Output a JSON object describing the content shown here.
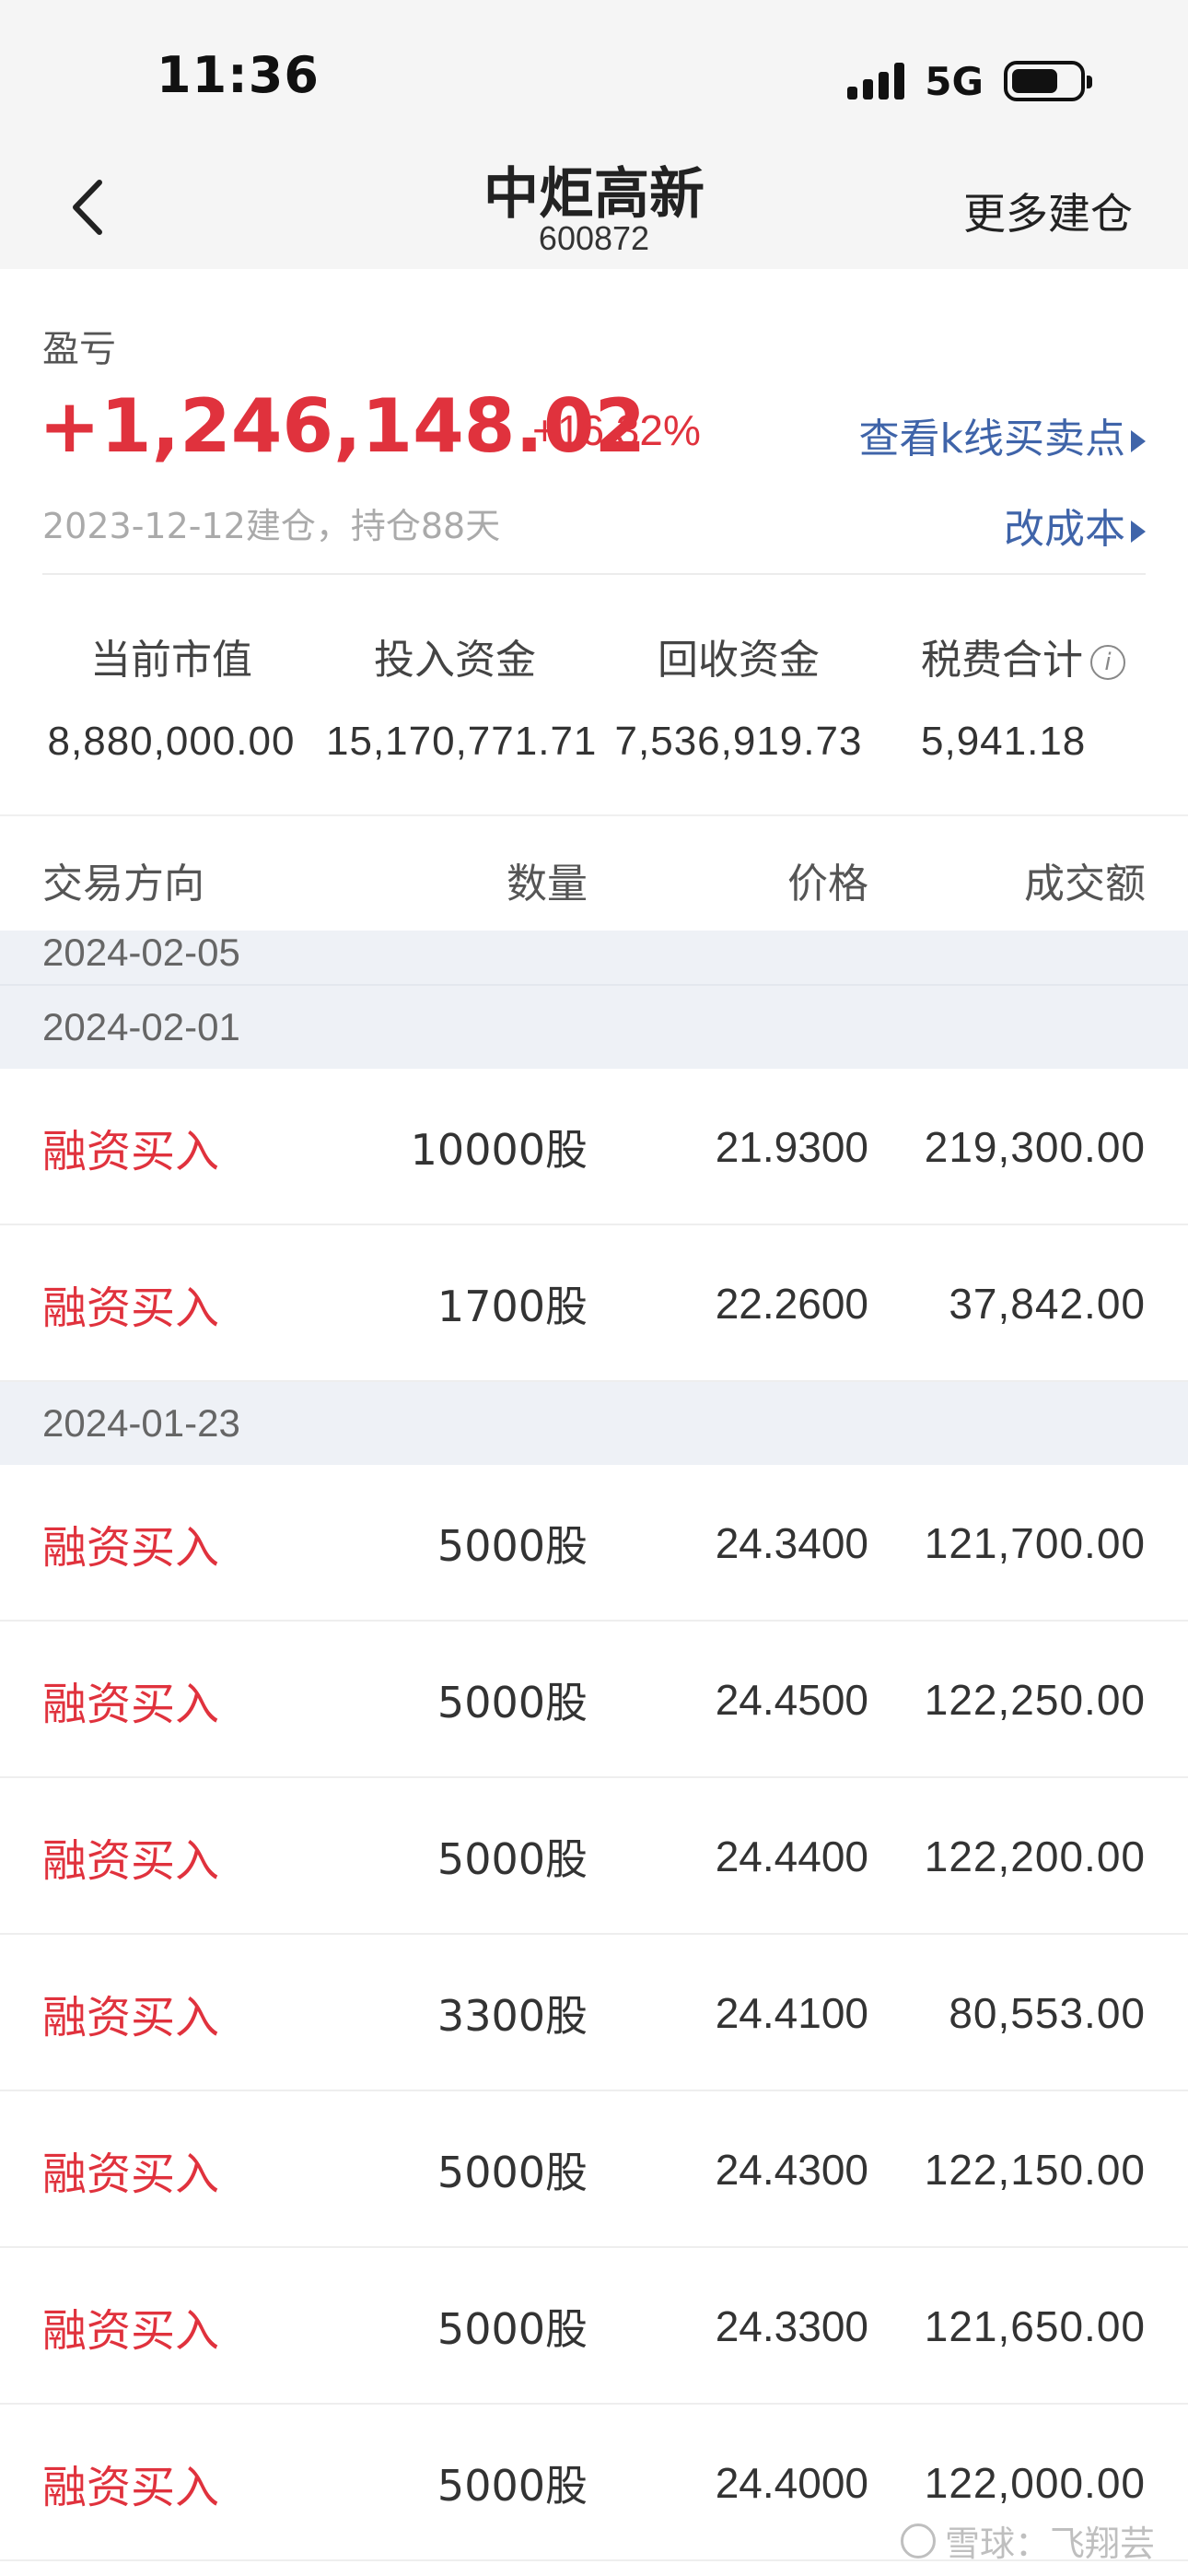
{
  "status_bar": {
    "time": "11:36",
    "network": "5G",
    "battery_level": 0.7
  },
  "nav": {
    "title": "中炬高新",
    "code": "600872",
    "more_label": "更多建仓",
    "back_icon": "chevron-left-icon"
  },
  "pnl": {
    "label": "盈亏",
    "amount": "+1,246,148.02",
    "percent": "+16.32%",
    "kline_link": "查看k线买卖点",
    "sub_info": "2023-12-12建仓，持仓88天",
    "cost_link": "改成本",
    "accent_color": "#e0323d",
    "link_color": "#3f64a9"
  },
  "summary": [
    {
      "label": "当前市值",
      "value": "8,880,000.00"
    },
    {
      "label": "投入资金",
      "value": "15,170,771.71"
    },
    {
      "label": "回收资金",
      "value": "7,536,919.73"
    },
    {
      "label": "税费合计",
      "value": "5,941.18"
    }
  ],
  "table": {
    "headers": {
      "direction": "交易方向",
      "qty": "数量",
      "price": "价格",
      "amount": "成交额"
    },
    "groups": [
      {
        "date": "2024-02-05",
        "trades": []
      },
      {
        "date": "2024-02-01",
        "trades": [
          {
            "direction": "融资买入",
            "qty": "10000股",
            "price": "21.9300",
            "amount": "219,300.00"
          },
          {
            "direction": "融资买入",
            "qty": "1700股",
            "price": "22.2600",
            "amount": "37,842.00"
          }
        ]
      },
      {
        "date": "2024-01-23",
        "trades": [
          {
            "direction": "融资买入",
            "qty": "5000股",
            "price": "24.3400",
            "amount": "121,700.00"
          },
          {
            "direction": "融资买入",
            "qty": "5000股",
            "price": "24.4500",
            "amount": "122,250.00"
          },
          {
            "direction": "融资买入",
            "qty": "5000股",
            "price": "24.4400",
            "amount": "122,200.00"
          },
          {
            "direction": "融资买入",
            "qty": "3300股",
            "price": "24.4100",
            "amount": "80,553.00"
          },
          {
            "direction": "融资买入",
            "qty": "5000股",
            "price": "24.4300",
            "amount": "122,150.00"
          },
          {
            "direction": "融资买入",
            "qty": "5000股",
            "price": "24.3300",
            "amount": "121,650.00"
          },
          {
            "direction": "融资买入",
            "qty": "5000股",
            "price": "24.4000",
            "amount": "122,000.00"
          }
        ]
      }
    ]
  },
  "watermark": "雪球：飞翔芸"
}
